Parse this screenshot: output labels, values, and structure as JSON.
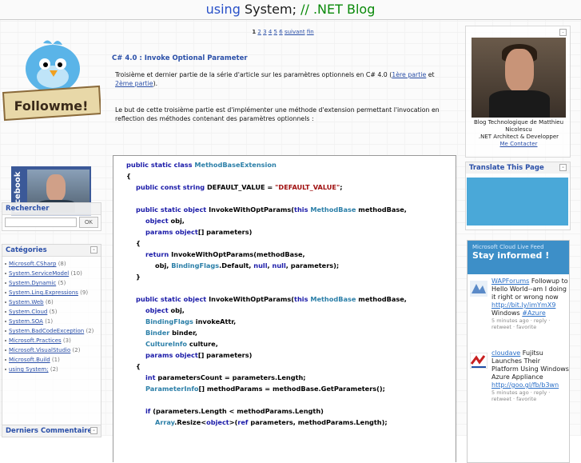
{
  "header": {
    "title_using": "using",
    "title_system": "System;",
    "title_sep": "//",
    "title_net": ".NET Blog"
  },
  "left": {
    "followme": "Followme!",
    "facebook": "facebook",
    "search": {
      "title": "Rechercher",
      "button": "OK",
      "placeholder": ""
    },
    "categories": {
      "title": "Catégories",
      "items": [
        {
          "label": "Microsoft.CSharp",
          "count": "(8)"
        },
        {
          "label": "System.ServiceModel",
          "count": "(10)"
        },
        {
          "label": "System.Dynamic",
          "count": "(5)"
        },
        {
          "label": "System.Linq.Expressions",
          "count": "(9)"
        },
        {
          "label": "System.Web",
          "count": "(6)"
        },
        {
          "label": "System.Cloud",
          "count": "(5)"
        },
        {
          "label": "System.SOA",
          "count": "(1)"
        },
        {
          "label": "System.BadCodeException",
          "count": "(2)"
        },
        {
          "label": "Microsoft.Practices",
          "count": "(3)"
        },
        {
          "label": "Microsoft.VisualStudio",
          "count": "(2)"
        },
        {
          "label": "Microsoft.Build",
          "count": "(1)"
        },
        {
          "label": "using System;",
          "count": "(2)"
        }
      ]
    },
    "comments_title": "Derniers Commentaires"
  },
  "pager": {
    "current": "1",
    "pages": [
      "2",
      "3",
      "4",
      "5",
      "6"
    ],
    "next": "suivant",
    "end": "fin"
  },
  "post": {
    "title": "C# 4.0 : Invoke Optional Parameter",
    "p1_a": "Troisième et dernier partie de la série d'article sur les paramètres optionnels en C# 4.0 (",
    "p1_link1": "1ère partie",
    "p1_b": " et ",
    "p1_link2": "2ème partie",
    "p1_c": ").",
    "p2": "Le but de cette troisième partie est d'implémenter une méthode d'extension permettant l'invocation en reflection des méthodes contenant des paramètres optionnels :"
  },
  "right": {
    "profile_caption": "Blog Technologique de Matthieu Nicolescu",
    "profile_role": ".NET Architect & Developper",
    "contact": "Me Contacter",
    "translate_title": "Translate This Page",
    "cloud": {
      "feed": "Microsoft Cloud Live Feed",
      "stay": "Stay informed !",
      "tweets": [
        {
          "user": "WAPForums",
          "text": " Followup to Hello World--am I doing it right or wrong now",
          "link": "http://bit.ly/imYmX9",
          "tail": " Windows ",
          "tag": "#Azure",
          "meta": "5 minutes ago · reply ·",
          "meta2": "retweet · favorite"
        },
        {
          "user": "cloudave",
          "text": " Fujitsu Launches Their Platform Using Windows Azure Appliance",
          "link": "http://goo.gl/fb/b3wn",
          "tail": "",
          "tag": "",
          "meta": "5 minutes ago · reply ·",
          "meta2": "retweet · favorite"
        }
      ]
    }
  },
  "colors": {
    "accent": "#2a4fa8",
    "keyword": "#1a1aa8",
    "type": "#2b7fa8",
    "string": "#a01010",
    "green": "#0a8a0a"
  }
}
